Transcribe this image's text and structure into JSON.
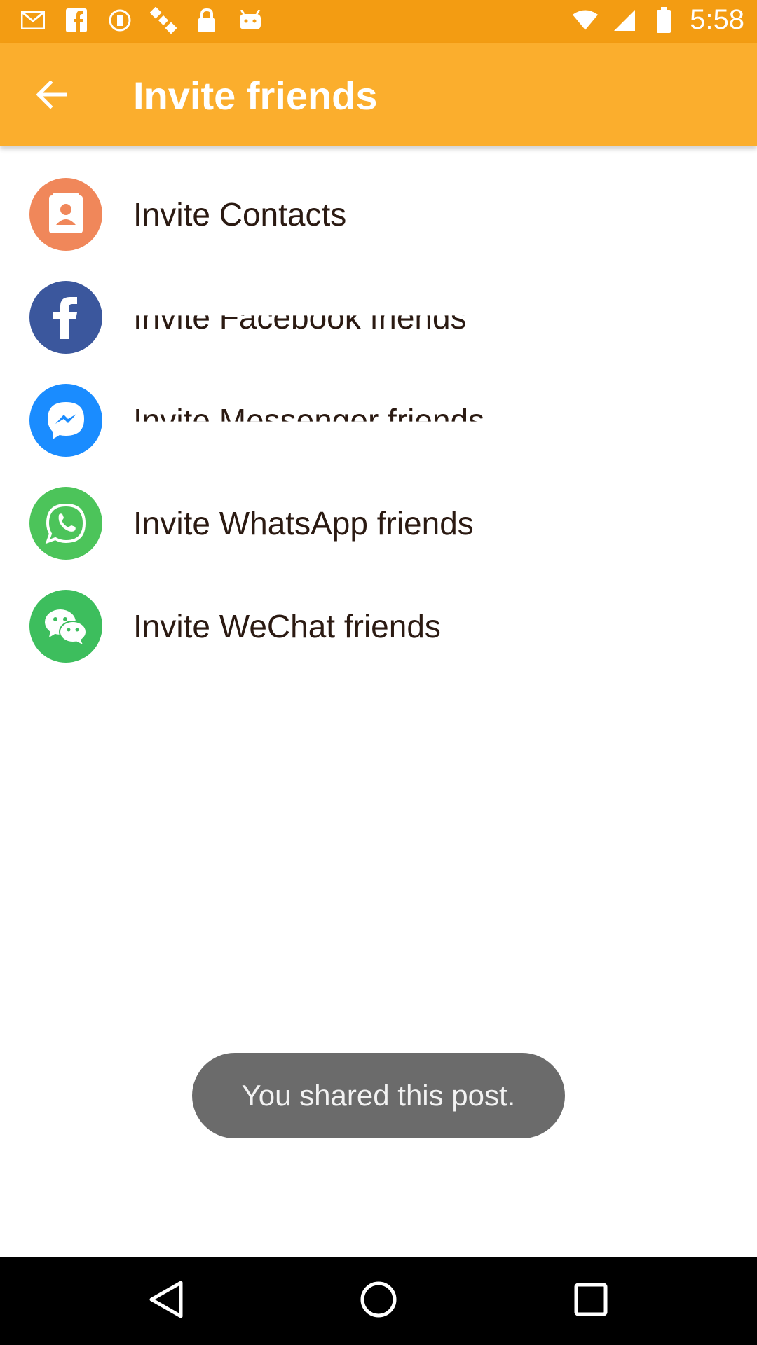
{
  "status_bar": {
    "time": "5:58",
    "icons": [
      "mail-icon",
      "facebook-icon",
      "sync-icon",
      "satellite-icon",
      "lock-icon",
      "android-icon",
      "wifi-icon",
      "signal-icon",
      "battery-icon"
    ]
  },
  "app_bar": {
    "title": "Invite friends",
    "back_icon": "arrow-left-icon",
    "color": "#FBAE2D"
  },
  "invite_list": [
    {
      "label": "Invite Contacts",
      "icon": "contacts-icon",
      "color": "#F0875A"
    },
    {
      "label": "Invite Facebook friends",
      "icon": "facebook-icon",
      "color": "#3B579D"
    },
    {
      "label": "Invite Messenger friends",
      "icon": "messenger-icon",
      "color": "#1A8CFF"
    },
    {
      "label": "Invite WhatsApp friends",
      "icon": "whatsapp-icon",
      "color": "#4CC45A"
    },
    {
      "label": "Invite WeChat friends",
      "icon": "wechat-icon",
      "color": "#3DBE5D"
    }
  ],
  "toast": {
    "message": "You shared this post."
  },
  "nav_bar": {
    "buttons": [
      "back-triangle-icon",
      "home-circle-icon",
      "recents-square-icon"
    ]
  }
}
